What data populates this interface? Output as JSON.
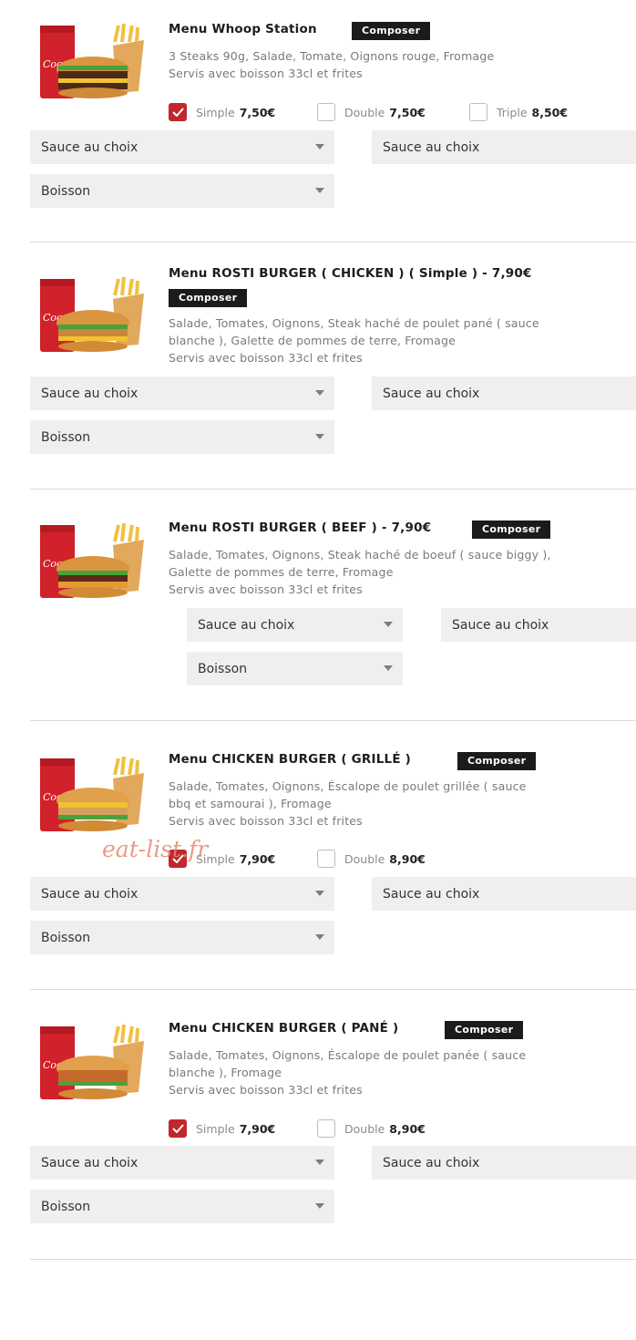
{
  "composer_label": "Composer",
  "watermark": "eat-list.fr",
  "items": [
    {
      "title": "Menu Whoop Station",
      "desc": [
        "3 Steaks 90g, Salade, Tomate, Oignons rouge, Fromage",
        "Servis avec boisson 33cl et frites"
      ],
      "options": [
        {
          "label": "Simple",
          "price": "7,50€",
          "checked": true
        },
        {
          "label": "Double",
          "price": "7,50€",
          "checked": false
        },
        {
          "label": "Triple",
          "price": "8,50€",
          "checked": false
        }
      ],
      "selects": [
        "Sauce au choix",
        "Sauce au choix",
        "Boisson"
      ]
    },
    {
      "title": "Menu ROSTI BURGER ( CHICKEN ) ( Simple ) - 7,90€",
      "desc": [
        "Salade, Tomates, Oignons, Steak haché de poulet pané ( sauce",
        "blanche ), Galette de pommes de terre, Fromage",
        "Servis avec boisson 33cl et frites"
      ],
      "options": [],
      "selects": [
        "Sauce au choix",
        "Sauce au choix",
        "Boisson"
      ]
    },
    {
      "title": "Menu ROSTI BURGER ( BEEF ) - 7,90€",
      "desc": [
        "Salade, Tomates, Oignons, Steak haché de boeuf ( sauce biggy ),",
        "Galette de pommes de terre, Fromage",
        "Servis avec boisson 33cl et frites"
      ],
      "options": [],
      "selects": [
        "Sauce au choix",
        "Sauce au choix",
        "Boisson"
      ]
    },
    {
      "title": "Menu CHICKEN BURGER ( GRILLÉ )",
      "desc": [
        "Salade, Tomates, Oignons, Éscalope de poulet grillée ( sauce",
        "bbq et samourai ), Fromage",
        "Servis avec boisson 33cl et frites"
      ],
      "options": [
        {
          "label": "Simple",
          "price": "7,90€",
          "checked": true
        },
        {
          "label": "Double",
          "price": "8,90€",
          "checked": false
        }
      ],
      "selects": [
        "Sauce au choix",
        "Sauce au choix",
        "Boisson"
      ]
    },
    {
      "title": "Menu CHICKEN BURGER ( PANÉ )",
      "desc": [
        "Salade, Tomates, Oignons, Éscalope de poulet panée ( sauce",
        "blanche ), Fromage",
        "Servis avec boisson 33cl et frites"
      ],
      "options": [
        {
          "label": "Simple",
          "price": "7,90€",
          "checked": true
        },
        {
          "label": "Double",
          "price": "8,90€",
          "checked": false
        }
      ],
      "selects": [
        "Sauce au choix",
        "Sauce au choix",
        "Boisson"
      ]
    }
  ]
}
